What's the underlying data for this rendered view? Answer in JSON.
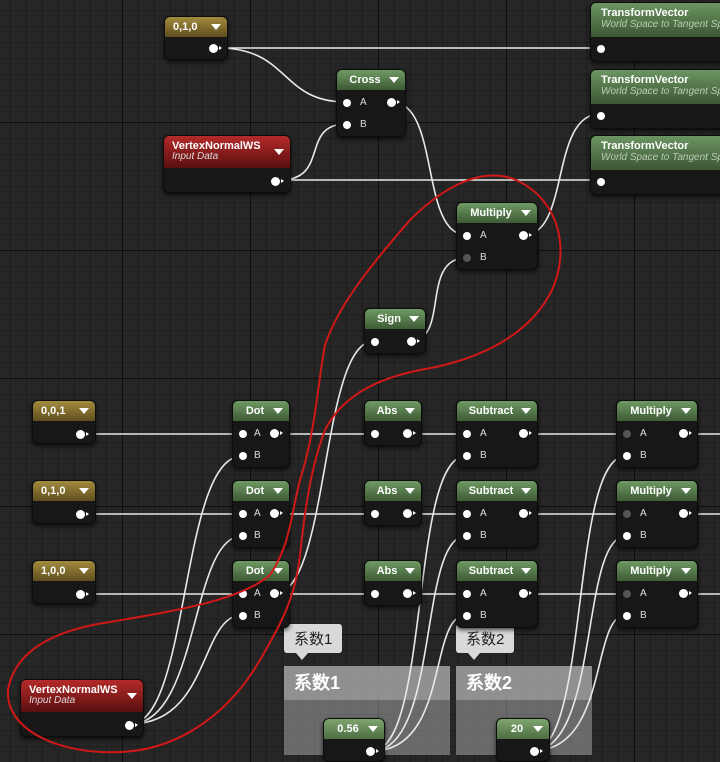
{
  "colors": {
    "background": "#262626",
    "math_header": "#4f7445",
    "constant_header": "#7d6a2c",
    "input_header": "#8e1c1c",
    "annotation": "#d01818"
  },
  "nodes": {
    "const_top": {
      "title": "0,1,0"
    },
    "cross": {
      "title": "Cross",
      "pin_a": "A",
      "pin_b": "B"
    },
    "vn_top": {
      "title": "VertexNormalWS",
      "subtitle": "Input Data"
    },
    "tv1": {
      "title": "TransformVector",
      "subtitle": "World Space to Tangent Sp"
    },
    "tv2": {
      "title": "TransformVector",
      "subtitle": "World Space to Tangent Sp"
    },
    "tv3": {
      "title": "TransformVector",
      "subtitle": "World Space to Tangent Sp"
    },
    "mult_top": {
      "title": "Multiply",
      "pin_a": "A",
      "pin_b": "B"
    },
    "sign": {
      "title": "Sign"
    },
    "c001": {
      "title": "0,0,1"
    },
    "c010": {
      "title": "0,1,0"
    },
    "c100": {
      "title": "1,0,0"
    },
    "dot1": {
      "title": "Dot",
      "pin_a": "A",
      "pin_b": "B"
    },
    "dot2": {
      "title": "Dot",
      "pin_a": "A",
      "pin_b": "B"
    },
    "dot3": {
      "title": "Dot",
      "pin_a": "A",
      "pin_b": "B"
    },
    "abs1": {
      "title": "Abs"
    },
    "abs2": {
      "title": "Abs"
    },
    "abs3": {
      "title": "Abs"
    },
    "sub1": {
      "title": "Subtract",
      "pin_a": "A",
      "pin_b": "B"
    },
    "sub2": {
      "title": "Subtract",
      "pin_a": "A",
      "pin_b": "B"
    },
    "sub3": {
      "title": "Subtract",
      "pin_a": "A",
      "pin_b": "B"
    },
    "mul1": {
      "title": "Multiply",
      "pin_a": "A",
      "pin_b": "B"
    },
    "mul2": {
      "title": "Multiply",
      "pin_a": "A",
      "pin_b": "B"
    },
    "mul3": {
      "title": "Multiply",
      "pin_a": "A",
      "pin_b": "B"
    },
    "vn_bottom": {
      "title": "VertexNormalWS",
      "subtitle": "Input Data"
    },
    "val1": {
      "title": "0.56"
    },
    "val2": {
      "title": "20"
    }
  },
  "comments": {
    "c1": {
      "bubble": "系数1",
      "title": "系数1"
    },
    "c2": {
      "bubble": "系数2",
      "title": "系数2"
    }
  }
}
